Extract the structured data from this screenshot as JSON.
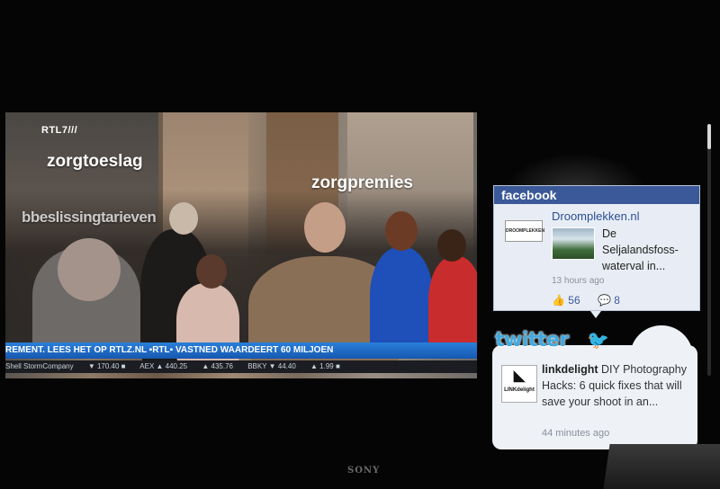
{
  "video": {
    "channel_logo": "RTL7///",
    "captions": [
      "zorgtoeslag",
      "zorgpremies",
      "bbeslissingtarieven"
    ],
    "ticker_text": "REMENT. LEES HET OP RTLZ.NL     ▪RTL▪     VASTNED  WAARDEERT 60 MILJOEN",
    "stock_items": [
      "Shell StormCompany",
      "▼ 170.40 ■",
      "AEX ▲ 440.25",
      "▲ 435.76",
      "BBKY ▼ 44.40",
      "▲ 1.99 ■"
    ]
  },
  "facebook": {
    "header": "facebook",
    "page_name": "Droomplekken.nl",
    "logo_text": "DROOMPLEKKEN",
    "post_text": "De Seljalandsfoss-waterval in...",
    "time": "13 hours ago",
    "likes": "56",
    "comments": "8"
  },
  "twitter": {
    "logo": "twitter",
    "user": "linkdelight",
    "avatar_text": "LINKdelight",
    "tweet_text": "DIY Photography Hacks: 6 quick fixes that will save your shoot in an...",
    "time": "44 minutes ago"
  },
  "tv": {
    "brand": "SONY"
  },
  "colors": {
    "facebook_blue": "#3b5998",
    "twitter_blue": "#3fa9e0",
    "ticker_blue": "#1f6fd0"
  }
}
